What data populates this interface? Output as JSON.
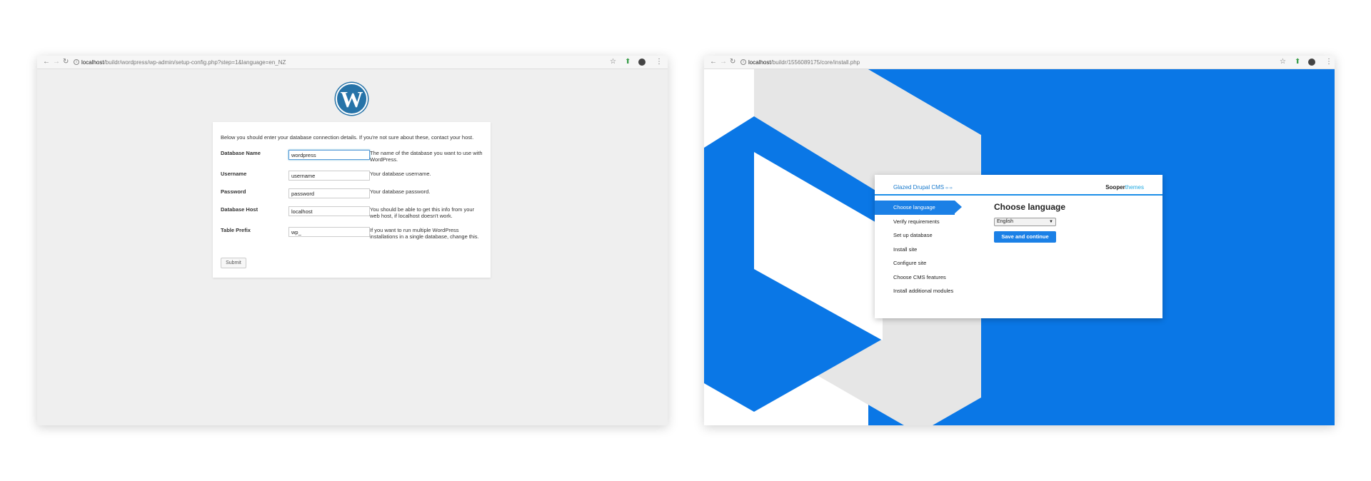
{
  "left_window": {
    "url_host": "localhost",
    "url_path": "/buildr/wordpress/wp-admin/setup-config.php?step=1&language=en_NZ",
    "logo_letter": "W",
    "intro": "Below you should enter your database connection details. If you're not sure about these, contact your host.",
    "fields": [
      {
        "label": "Database Name",
        "value": "wordpress",
        "help": "The name of the database you want to use with WordPress."
      },
      {
        "label": "Username",
        "value": "username",
        "help": "Your database username."
      },
      {
        "label": "Password",
        "value": "password",
        "help": "Your database password."
      },
      {
        "label": "Database Host",
        "value": "localhost",
        "help": "You should be able to get this info from your web host, if localhost doesn't work."
      },
      {
        "label": "Table Prefix",
        "value": "wp_",
        "help": "If you want to run multiple WordPress installations in a single database, change this."
      }
    ],
    "submit_label": "Submit"
  },
  "right_window": {
    "url_host": "localhost",
    "url_path": "/buildr/1556089175/core/install.php",
    "brand": "Glazed Drupal CMS",
    "brand_mark": "‹› ‹›",
    "logo_main": "Sooper",
    "logo_accent": "themes",
    "steps": [
      "Choose language",
      "Verify requirements",
      "Set up database",
      "Install site",
      "Configure site",
      "Choose CMS features",
      "Install additional modules"
    ],
    "heading": "Choose language",
    "language_selected": "English",
    "save_label": "Save and continue"
  },
  "icons": {
    "back": "arrow-left-icon",
    "forward": "arrow-right-icon",
    "reload": "reload-icon",
    "info": "info-icon",
    "bookmark": "star-icon",
    "menu": "kebab-menu-icon"
  },
  "colors": {
    "wp_blue": "#2673a8",
    "drupal_blue": "#0a77e6",
    "wp_bg": "#efefef"
  }
}
